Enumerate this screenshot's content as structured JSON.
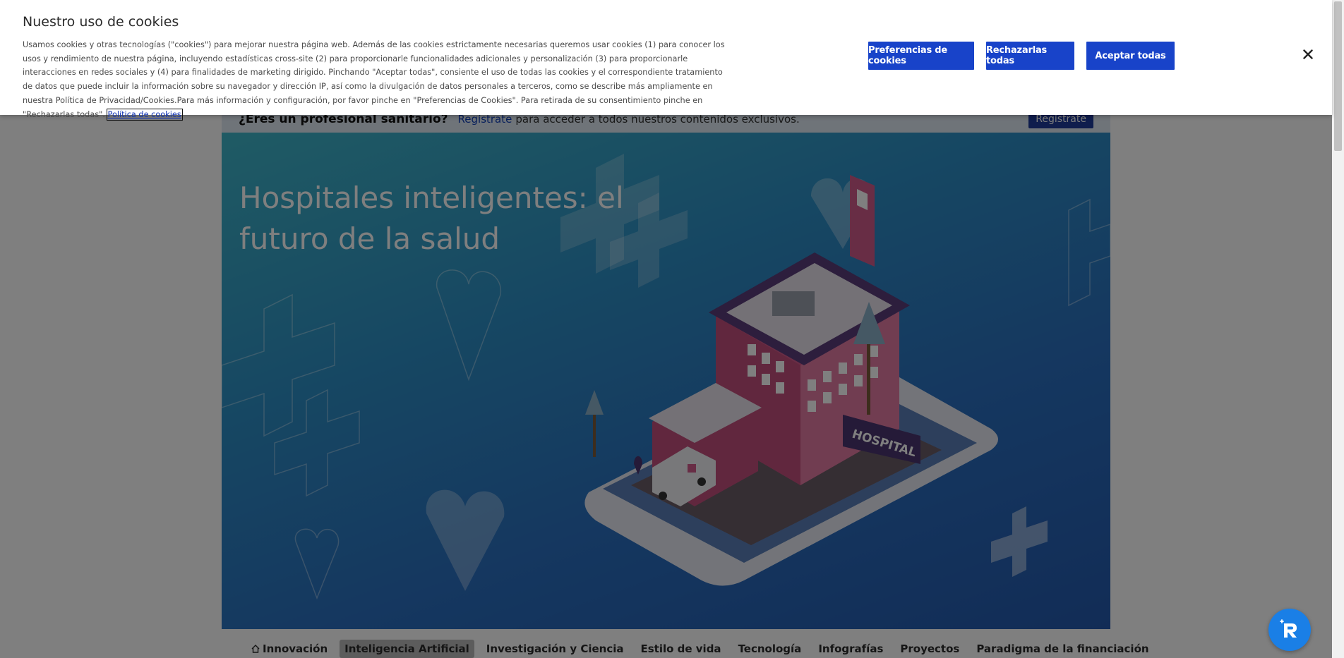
{
  "cookie_banner": {
    "title": "Nuestro uso de cookies",
    "text": "Usamos cookies y otras tecnologías (\"cookies\") para mejorar nuestra página web. Además de las cookies estrictamente necesarias queremos usar cookies (1) para conocer los usos y rendimiento de nuestra página, incluyendo estadísticas cross-site (2) para proporcionarle funcionalidades adicionales y personalización (3) para proporcionarle interacciones en redes sociales y (4) para finalidades de marketing dirigido. Pinchando \"Aceptar todas\", consiente el uso de todas las cookies y el correspondiente tratamiento de datos que puede incluir la información sobre su navegador y dirección IP, así como la divulgación de datos personales a terceros, como se describe más ampliamente en nuestra Política de Privacidad/Cookies.Para más información y configuración, por favor pinche en \"Preferencias de Cookies\". Para retirada de su consentimiento pinche en \"Rechazarlas todas\".",
    "policy_link": "Política de cookies",
    "prefs_label": "Preferencias de cookies",
    "reject_label": "Rechazarlas todas",
    "accept_label": "Aceptar todas",
    "close_icon": "close-icon"
  },
  "register_bar": {
    "question": "¿Eres un profesional sanitario?",
    "link": "Regístrate",
    "text": "para acceder a todos nuestros contenidos exclusivos.",
    "button": "Regístrate"
  },
  "hero": {
    "title": "Hospitales inteligentes: el futuro de la salud",
    "image_sign": "HOSPITAL"
  },
  "nav": {
    "items": [
      {
        "label": "Innovación",
        "icon": "home-icon",
        "active": false
      },
      {
        "label": "Inteligencia Artificial",
        "active": true
      },
      {
        "label": "Investigación y Ciencia",
        "active": false
      },
      {
        "label": "Estilo de vida",
        "active": false
      },
      {
        "label": "Tecnología",
        "active": false
      },
      {
        "label": "Infografías",
        "active": false
      },
      {
        "label": "Proyectos",
        "active": false
      },
      {
        "label": "Paradigma de la financiación",
        "active": false
      }
    ]
  },
  "colors": {
    "button_blue": "#1843c9",
    "hero_gradient_start": "#3fb6c8",
    "hero_gradient_end": "#2459ad",
    "fab_blue": "#1a7fe6"
  },
  "floating_button": {
    "icon": "chat-assistant-icon"
  }
}
